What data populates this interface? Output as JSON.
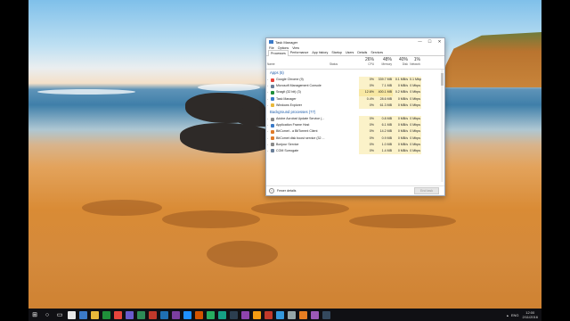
{
  "window": {
    "title": "Task Manager",
    "controls": [
      "—",
      "☐",
      "✕"
    ]
  },
  "menu": [
    "File",
    "Options",
    "View"
  ],
  "tabs": [
    {
      "label": "Processes",
      "active": true
    },
    {
      "label": "Performance",
      "active": false
    },
    {
      "label": "App history",
      "active": false
    },
    {
      "label": "Startup",
      "active": false
    },
    {
      "label": "Users",
      "active": false
    },
    {
      "label": "Details",
      "active": false
    },
    {
      "label": "Services",
      "active": false
    }
  ],
  "columns": {
    "name": "Name",
    "status": "Status",
    "cpu": {
      "pct": "26%",
      "label": "CPU"
    },
    "memory": {
      "pct": "48%",
      "label": "Memory"
    },
    "disk": {
      "pct": "40%",
      "label": "Disk"
    },
    "network": {
      "pct": "1%",
      "label": "Network"
    }
  },
  "groups": {
    "apps": "Apps (5)",
    "background": "Background processes (77)"
  },
  "apps": [
    {
      "name": "Google Chrome (9)",
      "cpu": "0%",
      "mem": "339.7 MB",
      "disk": "0.1 MB/s",
      "net": "0.1 Mbps",
      "color": "#e8453c"
    },
    {
      "name": "Microsoft Management Console",
      "cpu": "0%",
      "mem": "7.1 MB",
      "disk": "0 MB/s",
      "net": "0 Mbps",
      "color": "#6a7f99"
    },
    {
      "name": "Snagit (32 bit) (3)",
      "cpu": "12.6%",
      "mem": "400.1 MB",
      "disk": "0.2 MB/s",
      "net": "0 Mbps",
      "color": "#1f8f3a"
    },
    {
      "name": "Task Manager",
      "cpu": "0.4%",
      "mem": "28.6 MB",
      "disk": "0 MB/s",
      "net": "0 Mbps",
      "color": "#3b7ac8"
    },
    {
      "name": "Windows Explorer",
      "cpu": "0%",
      "mem": "61.3 MB",
      "disk": "0 MB/s",
      "net": "0 Mbps",
      "color": "#e9b93a"
    }
  ],
  "background": [
    {
      "name": "Adobe Acrobat Update Service (...",
      "cpu": "0%",
      "mem": "0.8 MB",
      "disk": "0 MB/s",
      "net": "0 Mbps",
      "color": "#8a8a8a"
    },
    {
      "name": "Application Frame Host",
      "cpu": "0%",
      "mem": "6.1 MB",
      "disk": "0 MB/s",
      "net": "0 Mbps",
      "color": "#3b7ac8"
    },
    {
      "name": "BitComet - a BitTorrent Client",
      "cpu": "0%",
      "mem": "14.2 MB",
      "disk": "0 MB/s",
      "net": "0 Mbps",
      "color": "#e07b2a"
    },
    {
      "name": "BitComet disk boost service (32 ...",
      "cpu": "0%",
      "mem": "0.9 MB",
      "disk": "0 MB/s",
      "net": "0 Mbps",
      "color": "#e07b2a"
    },
    {
      "name": "Bonjour Service",
      "cpu": "0%",
      "mem": "1.0 MB",
      "disk": "0 MB/s",
      "net": "0 Mbps",
      "color": "#8a8a8a"
    },
    {
      "name": "COM Surrogate",
      "cpu": "0%",
      "mem": "1.4 MB",
      "disk": "0 MB/s",
      "net": "0 Mbps",
      "color": "#6a7f99"
    }
  ],
  "footer": {
    "fewer": "Fewer details",
    "end_task": "End task"
  },
  "taskbar": {
    "start": "⊞",
    "search": "○",
    "taskview": "▭",
    "apps": [
      "#e8e8e8",
      "#3b7ac8",
      "#e9b93a",
      "#1f8f3a",
      "#e8453c",
      "#6a5acd",
      "#2e8b57",
      "#c0392b",
      "#1f6fb2",
      "#7b3fa0",
      "#1e90ff",
      "#d35400",
      "#27ae60",
      "#16a085",
      "#2c3e50",
      "#8e44ad",
      "#f39c12",
      "#c0392b",
      "#3498db",
      "#95a5a6",
      "#e67e22",
      "#9b59b6",
      "#34495e"
    ],
    "lang": "ENG",
    "time": "12:00",
    "date": "2/11/2016"
  }
}
